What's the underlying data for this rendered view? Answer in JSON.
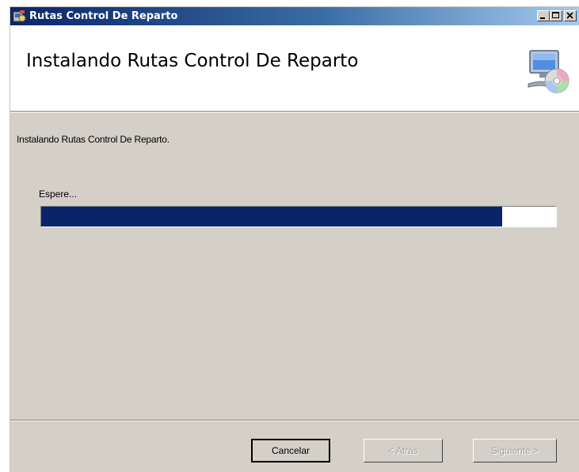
{
  "window": {
    "title": "Rutas Control De Reparto",
    "minimize_glyph": "_",
    "maximize_glyph": "□",
    "close_glyph": "X"
  },
  "banner": {
    "heading": "Instalando Rutas Control De Reparto",
    "icon": "computer-cd-icon"
  },
  "content": {
    "status_text": "Instalando Rutas Control De Reparto.",
    "wait_label": "Espere...",
    "progress_fraction": 0.895
  },
  "buttons": {
    "cancel": "Cancelar",
    "back": "< Atrás",
    "next": "Siguiente >"
  },
  "colors": {
    "title_gradient_start": "#0a246a",
    "title_gradient_end": "#a6caf0",
    "progress_fill": "#0a246a",
    "dialog_bg": "#d4d0c8"
  }
}
